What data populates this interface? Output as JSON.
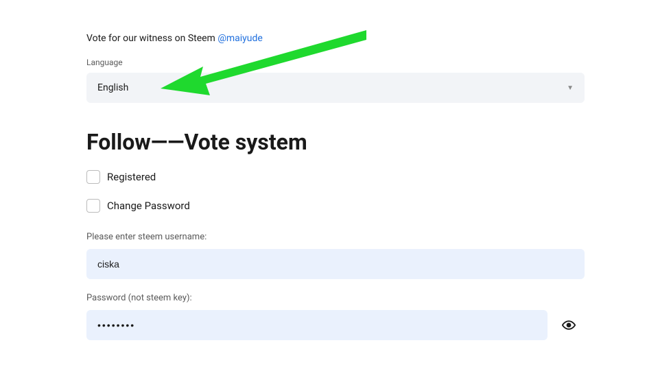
{
  "witness": {
    "prefix": "Vote for our witness on Steem ",
    "handle": "@maiyude"
  },
  "language": {
    "label": "Language",
    "selected": "English"
  },
  "heading": "Follow——Vote system",
  "checkboxes": {
    "registered": "Registered",
    "change_password": "Change Password"
  },
  "username": {
    "label": "Please enter steem username:",
    "value": "ciska"
  },
  "password": {
    "label": "Password (not steem key):",
    "value": "••••••••"
  },
  "colors": {
    "link": "#1f6fde",
    "input_bg": "#eaf1fd",
    "select_bg": "#f2f4f7",
    "arrow": "#1fd92e"
  }
}
